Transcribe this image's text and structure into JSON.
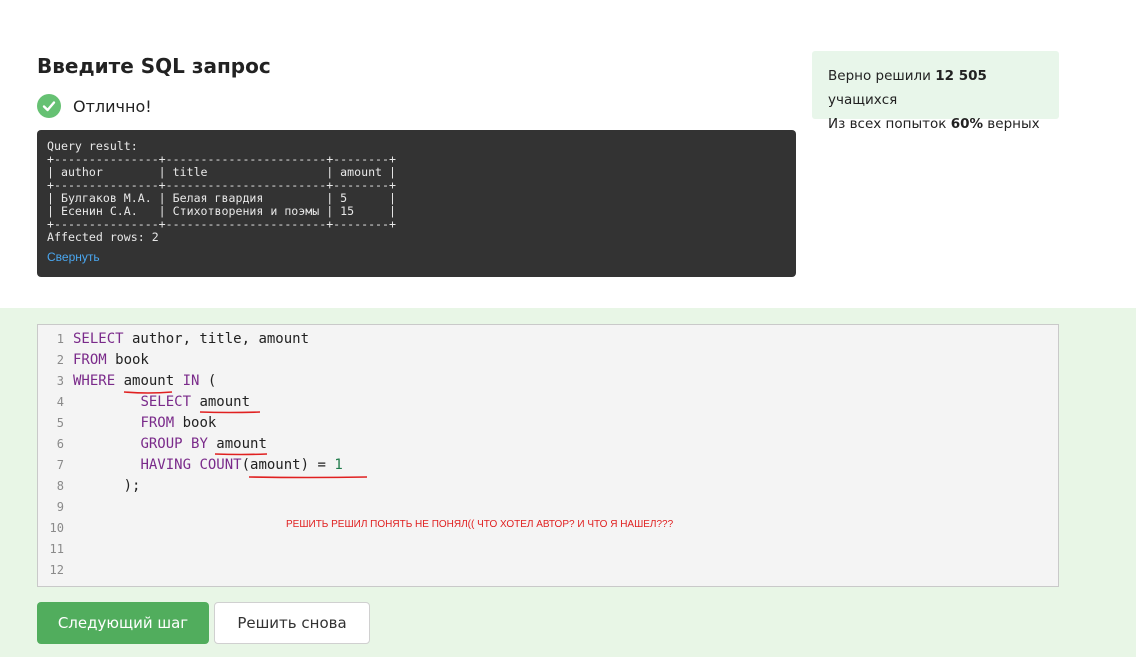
{
  "header": {
    "title": "Введите SQL запрос"
  },
  "status": {
    "text": "Отлично!",
    "icon": "check-circle-icon",
    "color": "#66c173"
  },
  "result": {
    "lines": [
      "Query result:",
      "+---------------+-----------------------+--------+",
      "| author        | title                 | amount |",
      "+---------------+-----------------------+--------+",
      "| Булгаков М.А. | Белая гвардия         | 5      |",
      "| Есенин С.А.   | Стихотворения и поэмы | 15     |",
      "+---------------+-----------------------+--------+",
      "Affected rows: 2"
    ],
    "collapse_label": "Свернуть"
  },
  "stats": {
    "solved_prefix": "Верно решили ",
    "solved_count": "12 505",
    "solved_suffix": " учащихся",
    "attempts_prefix": "Из всех попыток ",
    "attempts_percent": "60%",
    "attempts_suffix": " верных"
  },
  "editor": {
    "line_numbers": [
      "1",
      "2",
      "3",
      "4",
      "5",
      "6",
      "7",
      "8",
      "9",
      "10",
      "11",
      "12"
    ],
    "annotation": "РЕШИТЬ РЕШИЛ ПОНЯТЬ НЕ ПОНЯЛ(( ЧТО ХОТЕЛ АВТОР?  И ЧТО Я НАШЕЛ???"
  },
  "buttons": {
    "next_label": "Следующий шаг",
    "retry_label": "Решить снова"
  },
  "colors": {
    "accent": "#51ad5d",
    "keyword": "#7a2a8a",
    "number": "#1f7a4a",
    "annotation": "#e02020",
    "result_bg": "#333333",
    "link": "#4aa7f0"
  }
}
